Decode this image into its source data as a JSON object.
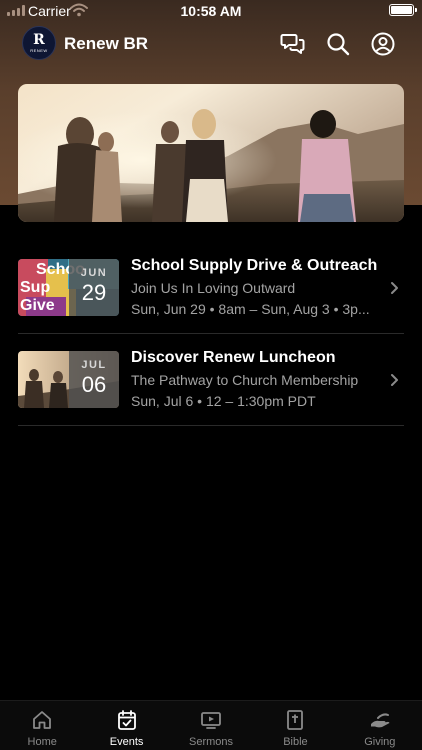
{
  "status_bar": {
    "carrier": "Carrier",
    "time": "10:58 AM"
  },
  "header": {
    "app_title": "Renew BR",
    "logo_letter": "R",
    "logo_text": "RENEW",
    "icons": [
      "chat-icon",
      "search-icon",
      "profile-icon"
    ]
  },
  "hero": {
    "image": "people-on-hillside-at-sunset"
  },
  "events": [
    {
      "title": "School Supply Drive & Outreach",
      "subtitle": "Join Us In Loving Outward",
      "time": "Sun, Jun 29 • 8am – Sun, Aug 3 • 3p...",
      "month": "JUN",
      "day": "29",
      "thumb_text": [
        "Schoo",
        "Sup",
        "Give"
      ]
    },
    {
      "title": "Discover Renew Luncheon",
      "subtitle": "The Pathway to Church Membership",
      "time": "Sun, Jul 6 • 12 – 1:30pm PDT",
      "month": "JUL",
      "day": "06"
    }
  ],
  "tabs": [
    {
      "label": "Home",
      "icon": "home-icon",
      "active": false
    },
    {
      "label": "Events",
      "icon": "calendar-icon",
      "active": true
    },
    {
      "label": "Sermons",
      "icon": "video-icon",
      "active": false
    },
    {
      "label": "Bible",
      "icon": "bible-icon",
      "active": false
    },
    {
      "label": "Giving",
      "icon": "giving-hand-icon",
      "active": false
    }
  ],
  "colors": {
    "background": "#000000",
    "header_tint": "#5a3f2c",
    "muted_text": "#a3a3a3",
    "inactive_tab": "#8a8a8a"
  }
}
